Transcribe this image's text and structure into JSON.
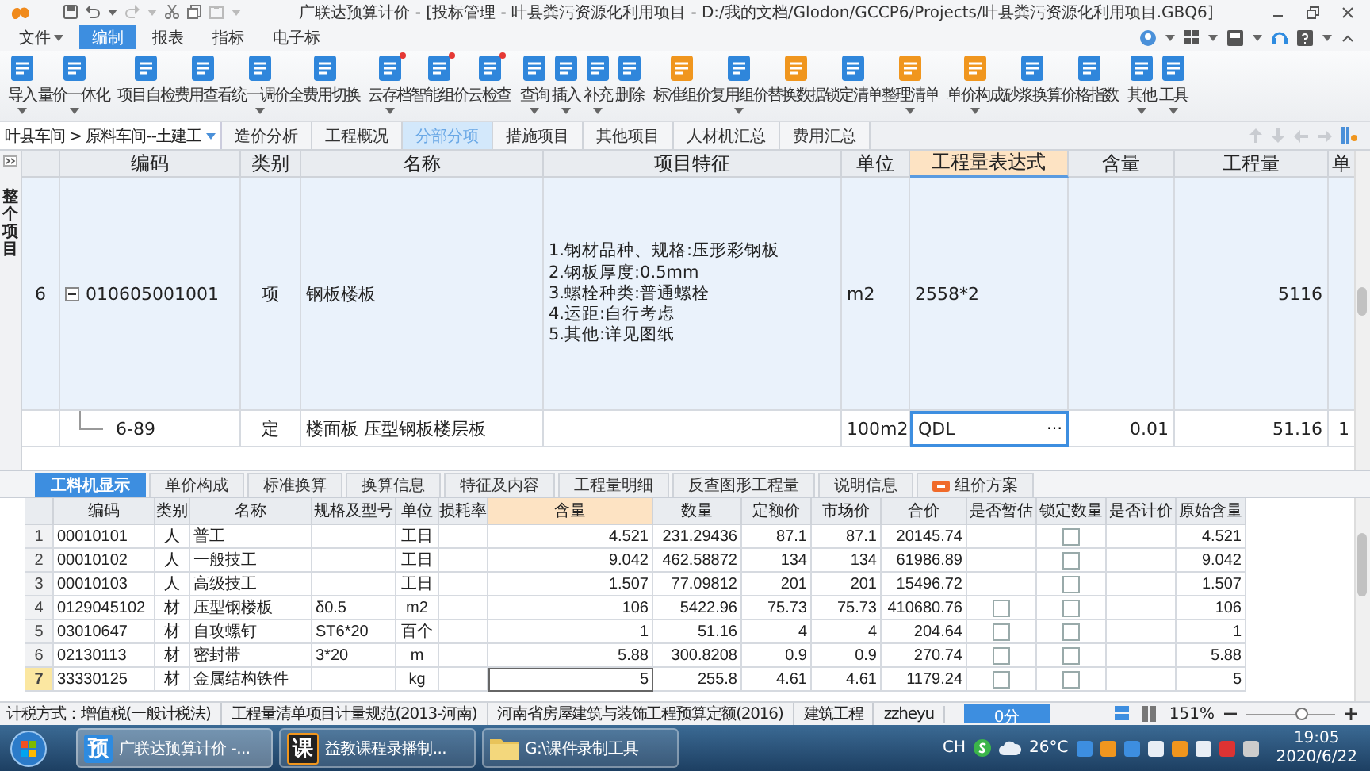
{
  "window": {
    "title": "广联达预算计价 - [投标管理 - 叶县粪污资源化利用项目 - D:/我的文档/Glodon/GCCP6/Projects/叶县粪污资源化利用项目.GBQ6]"
  },
  "menu": [
    {
      "label": "文件",
      "dropdown": true,
      "selected": false
    },
    {
      "label": "编制",
      "dropdown": false,
      "selected": true
    },
    {
      "label": "报表",
      "dropdown": false,
      "selected": false
    },
    {
      "label": "指标",
      "dropdown": false,
      "selected": false
    },
    {
      "label": "电子标",
      "dropdown": false,
      "selected": false
    }
  ],
  "ribbon": {
    "groups": [
      [
        {
          "label": "导入",
          "dropdown": true,
          "dot": false
        },
        {
          "label": "量价一体化",
          "dropdown": true,
          "dot": false
        }
      ],
      [
        {
          "label": "项目自检",
          "dropdown": false,
          "dot": false
        },
        {
          "label": "费用查看",
          "dropdown": false,
          "dot": false
        },
        {
          "label": "统一调价",
          "dropdown": true,
          "dot": false
        },
        {
          "label": "全费用切换",
          "dropdown": false,
          "dot": false
        }
      ],
      [
        {
          "label": "云存档",
          "dropdown": true,
          "dot": true
        },
        {
          "label": "智能组价",
          "dropdown": false,
          "dot": true
        },
        {
          "label": "云检查",
          "dropdown": false,
          "dot": true
        }
      ],
      [
        {
          "label": "查询",
          "dropdown": true,
          "dot": false
        },
        {
          "label": "插入",
          "dropdown": true,
          "dot": false
        },
        {
          "label": "补充",
          "dropdown": true,
          "dot": false
        },
        {
          "label": "删除",
          "dropdown": false,
          "dot": false
        }
      ],
      [
        {
          "label": "标准组价",
          "dropdown": false,
          "dot": false
        },
        {
          "label": "复用组价",
          "dropdown": true,
          "dot": false
        },
        {
          "label": "替换数据",
          "dropdown": false,
          "dot": false
        },
        {
          "label": "锁定清单",
          "dropdown": false,
          "dot": false
        },
        {
          "label": "整理清单",
          "dropdown": true,
          "dot": false
        }
      ],
      [
        {
          "label": "单价构成",
          "dropdown": true,
          "dot": false
        },
        {
          "label": "砂浆换算",
          "dropdown": false,
          "dot": false
        },
        {
          "label": "价格指数",
          "dropdown": false,
          "dot": false
        }
      ],
      [
        {
          "label": "其他",
          "dropdown": true,
          "dot": false
        },
        {
          "label": "工具",
          "dropdown": true,
          "dot": false
        }
      ]
    ]
  },
  "nav": {
    "breadcrumb": "叶县车间 > 原料车间--土建工",
    "tabs": [
      {
        "label": "造价分析",
        "selected": false
      },
      {
        "label": "工程概况",
        "selected": false
      },
      {
        "label": "分部分项",
        "selected": true
      },
      {
        "label": "措施项目",
        "selected": false
      },
      {
        "label": "其他项目",
        "selected": false
      },
      {
        "label": "人材机汇总",
        "selected": false
      },
      {
        "label": "费用汇总",
        "selected": false
      }
    ]
  },
  "side_panel": {
    "label": "整个项目"
  },
  "main_table": {
    "columns": [
      {
        "label": "编码",
        "selected": false
      },
      {
        "label": "类别",
        "selected": false
      },
      {
        "label": "名称",
        "selected": false
      },
      {
        "label": "项目特征",
        "selected": false
      },
      {
        "label": "单位",
        "selected": false
      },
      {
        "label": "工程量表达式",
        "selected": true
      },
      {
        "label": "含量",
        "selected": false
      },
      {
        "label": "工程量",
        "selected": false
      },
      {
        "label": "单",
        "selected": false
      }
    ],
    "rows": [
      {
        "kind": "bill",
        "number": "6",
        "expanded": true,
        "code": "010605001001",
        "type": "项",
        "name": "钢板楼板",
        "features": "1.钢材品种、规格:压形彩钢板\n2.钢板厚度:0.5mm\n3.螺栓种类:普通螺栓\n4.运距:自行考虑\n5.其他:详见图纸",
        "unit": "m2",
        "expression": "2558*2",
        "quantity": "5116",
        "editing": false
      },
      {
        "kind": "quota",
        "code": "6-89",
        "type": "定",
        "name": "楼面板 压型钢板楼层板",
        "unit": "100m2",
        "expression": "QDL",
        "content": "0.01",
        "quantity": "51.16",
        "column_11": "1",
        "editing": true,
        "editor_button": "⋯"
      }
    ]
  },
  "detail_tabs": [
    {
      "label": "工料机显示",
      "selected": true,
      "icon": false
    },
    {
      "label": "单价构成",
      "selected": false,
      "icon": false
    },
    {
      "label": "标准换算",
      "selected": false,
      "icon": false
    },
    {
      "label": "换算信息",
      "selected": false,
      "icon": false
    },
    {
      "label": "特征及内容",
      "selected": false,
      "icon": false
    },
    {
      "label": "工程量明细",
      "selected": false,
      "icon": false
    },
    {
      "label": "反查图形工程量",
      "selected": false,
      "icon": false
    },
    {
      "label": "说明信息",
      "selected": false,
      "icon": false
    },
    {
      "label": "组价方案",
      "selected": false,
      "icon": true
    }
  ],
  "detail_table": {
    "columns": [
      {
        "label": "编码",
        "selected": false
      },
      {
        "label": "类别",
        "selected": false
      },
      {
        "label": "名称",
        "selected": false
      },
      {
        "label": "规格及型号",
        "selected": false
      },
      {
        "label": "单位",
        "selected": false
      },
      {
        "label": "损耗率",
        "selected": false
      },
      {
        "label": "含量",
        "selected": true
      },
      {
        "label": "数量",
        "selected": false
      },
      {
        "label": "定额价",
        "selected": false
      },
      {
        "label": "市场价",
        "selected": false
      },
      {
        "label": "合价",
        "selected": false
      },
      {
        "label": "是否暂估",
        "selected": false
      },
      {
        "label": "锁定数量",
        "selected": false
      },
      {
        "label": "是否计价",
        "selected": false
      },
      {
        "label": "原始含量",
        "selected": false
      }
    ],
    "rows": [
      {
        "number": "1",
        "code": "00010101",
        "type": "人",
        "name": "普工",
        "unit": "工日",
        "content": "4.521",
        "quantity": "231.29436",
        "quota_price": "87.1",
        "market_price": "87.1",
        "total": "20145.74",
        "locked": false,
        "original_content": "4.521",
        "selected": false
      },
      {
        "number": "2",
        "code": "00010102",
        "type": "人",
        "name": "一般技工",
        "unit": "工日",
        "content": "9.042",
        "quantity": "462.58872",
        "quota_price": "134",
        "market_price": "134",
        "total": "61986.89",
        "locked": false,
        "original_content": "9.042",
        "selected": false
      },
      {
        "number": "3",
        "code": "00010103",
        "type": "人",
        "name": "高级技工",
        "unit": "工日",
        "content": "1.507",
        "quantity": "77.09812",
        "quota_price": "201",
        "market_price": "201",
        "total": "15496.72",
        "locked": false,
        "original_content": "1.507",
        "selected": false
      },
      {
        "number": "4",
        "code": "0129045102",
        "type": "材",
        "name": "压型钢楼板",
        "spec": "δ0.5",
        "unit": "m2",
        "content": "106",
        "quantity": "5422.96",
        "quota_price": "75.73",
        "market_price": "75.73",
        "total": "410680.76",
        "estimated": false,
        "locked": false,
        "original_content": "106",
        "selected": false
      },
      {
        "number": "5",
        "code": "03010647",
        "type": "材",
        "name": "自攻螺钉",
        "spec": "ST6*20",
        "unit": "百个",
        "content": "1",
        "quantity": "51.16",
        "quota_price": "4",
        "market_price": "4",
        "total": "204.64",
        "estimated": false,
        "locked": false,
        "original_content": "1",
        "selected": false
      },
      {
        "number": "6",
        "code": "02130113",
        "type": "材",
        "name": "密封带",
        "spec": "3*20",
        "unit": "m",
        "content": "5.88",
        "quantity": "300.8208",
        "quota_price": "0.9",
        "market_price": "0.9",
        "total": "270.74",
        "estimated": false,
        "locked": false,
        "original_content": "5.88",
        "selected": false
      },
      {
        "number": "7",
        "code": "33330125",
        "type": "材",
        "name": "金属结构铁件",
        "unit": "kg",
        "content": "5",
        "quantity": "255.8",
        "quota_price": "4.61",
        "market_price": "4.61",
        "total": "1179.24",
        "estimated": false,
        "locked": false,
        "original_content": "5",
        "selected": true
      }
    ]
  },
  "status_bar": {
    "items": [
      "计税方式：增值税(一般计税法)",
      "工程量清单项目计量规范(2013-河南)",
      "河南省房屋建筑与装饰工程预算定额(2016)",
      "建筑工程",
      "zzheyu"
    ],
    "score": "0分",
    "zoom": "151%",
    "zoom_slider": {
      "level": 0.62
    }
  },
  "taskbar": {
    "tasks": [
      {
        "kind": "app",
        "glyph": "预",
        "label": "广联达预算计价 -...",
        "active": true
      },
      {
        "kind": "app",
        "glyph": "课",
        "label": "益教课程录播制...",
        "active": false
      },
      {
        "kind": "folder",
        "label": "G:\\课件录制工具",
        "active": false
      }
    ],
    "ime": "CH",
    "temperature": "26°C",
    "time": "19:05",
    "date": "2020/6/22"
  }
}
